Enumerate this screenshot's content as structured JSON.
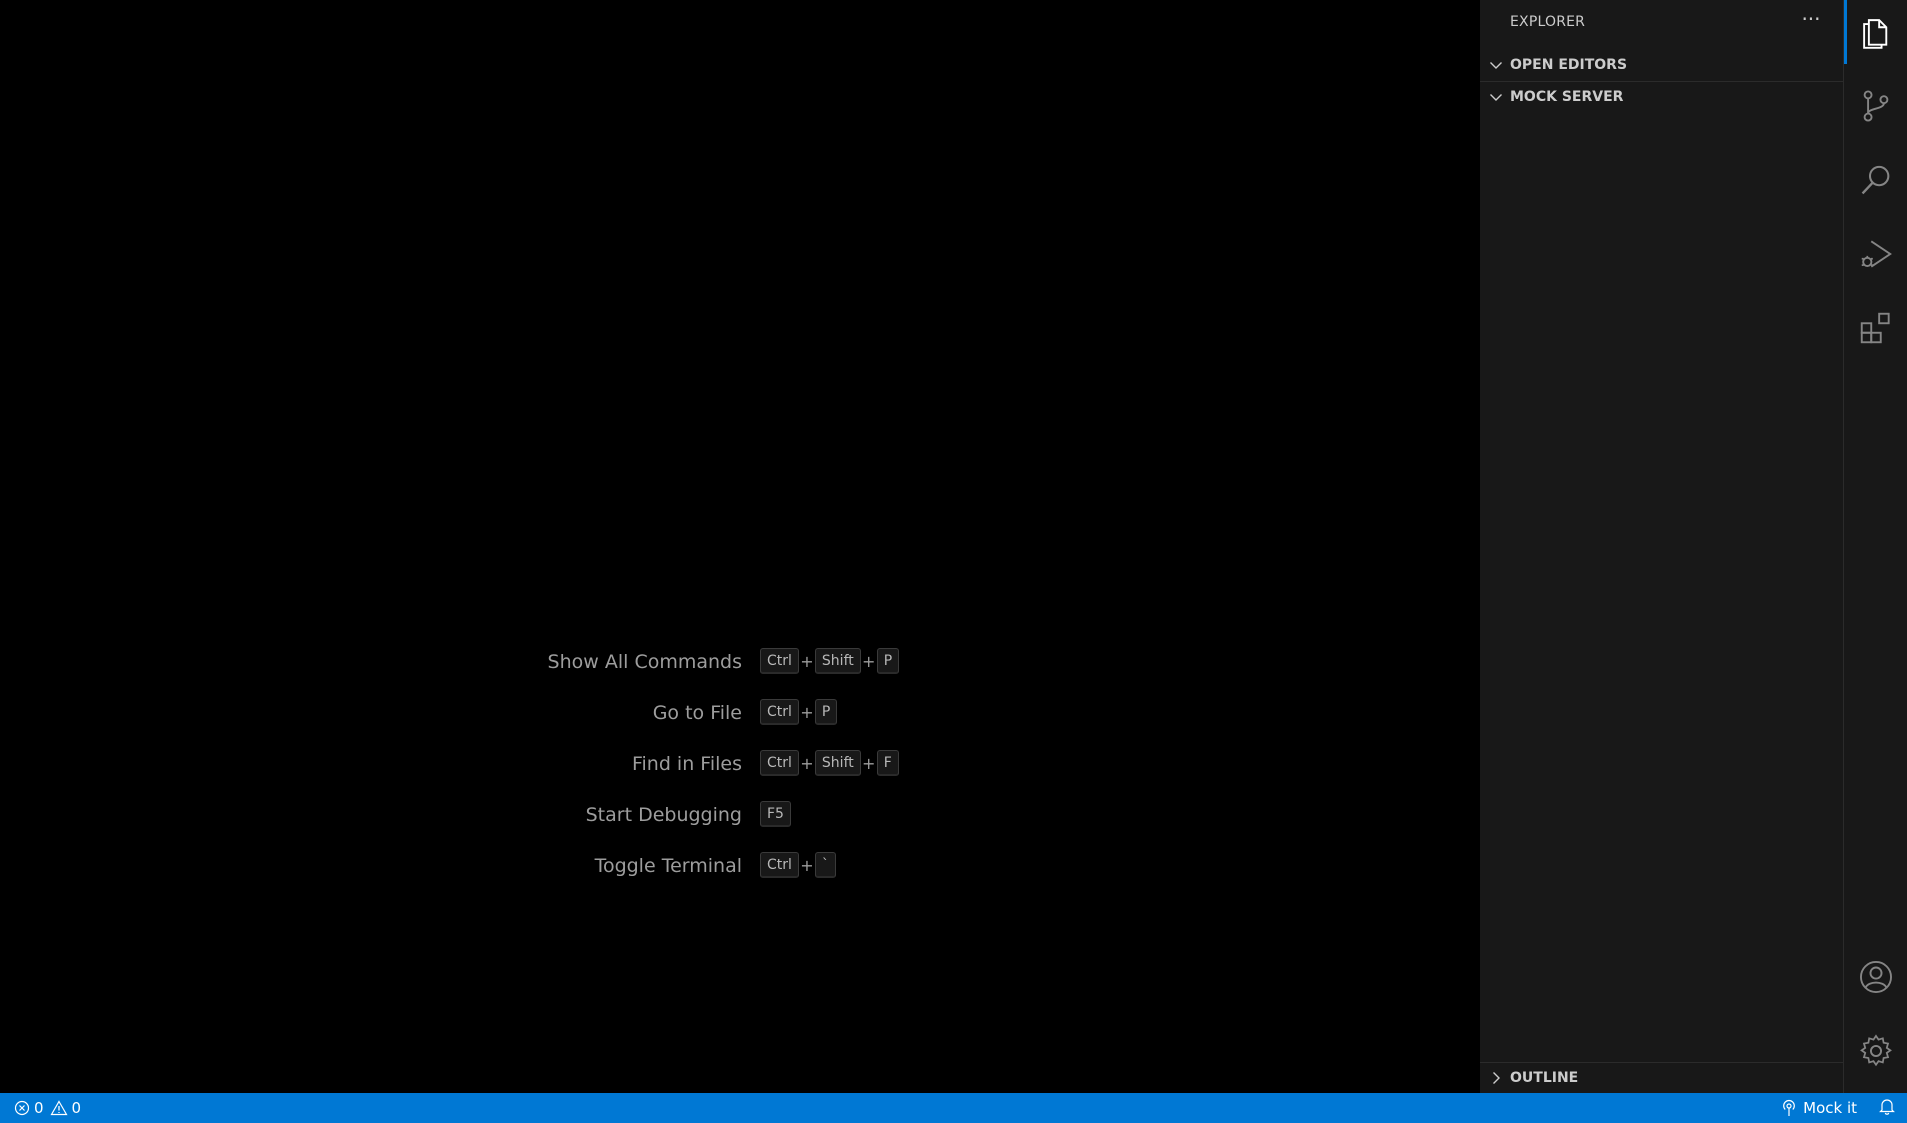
{
  "sidebar": {
    "title": "EXPLORER",
    "more_actions_icon": "ellipsis-icon",
    "sections": [
      {
        "label": "OPEN EDITORS",
        "expanded": true
      },
      {
        "label": "MOCK SERVER",
        "expanded": true
      },
      {
        "label": "OUTLINE",
        "expanded": false
      }
    ]
  },
  "editor": {
    "shortcuts": [
      {
        "label": "Show All Commands",
        "keys": [
          "Ctrl",
          "Shift",
          "P"
        ]
      },
      {
        "label": "Go to File",
        "keys": [
          "Ctrl",
          "P"
        ]
      },
      {
        "label": "Find in Files",
        "keys": [
          "Ctrl",
          "Shift",
          "F"
        ]
      },
      {
        "label": "Start Debugging",
        "keys": [
          "F5"
        ]
      },
      {
        "label": "Toggle Terminal",
        "keys": [
          "Ctrl",
          "`"
        ]
      }
    ]
  },
  "activity_bar": {
    "items": [
      "files-icon",
      "source-control-icon",
      "search-icon",
      "run-debug-icon",
      "extensions-icon"
    ],
    "bottom_items": [
      "account-icon",
      "settings-gear-icon"
    ]
  },
  "statusbar": {
    "errors": "0",
    "warnings": "0",
    "mock_label": "Mock it",
    "colors": {
      "background": "#0078d4",
      "foreground": "#ffffff"
    }
  }
}
